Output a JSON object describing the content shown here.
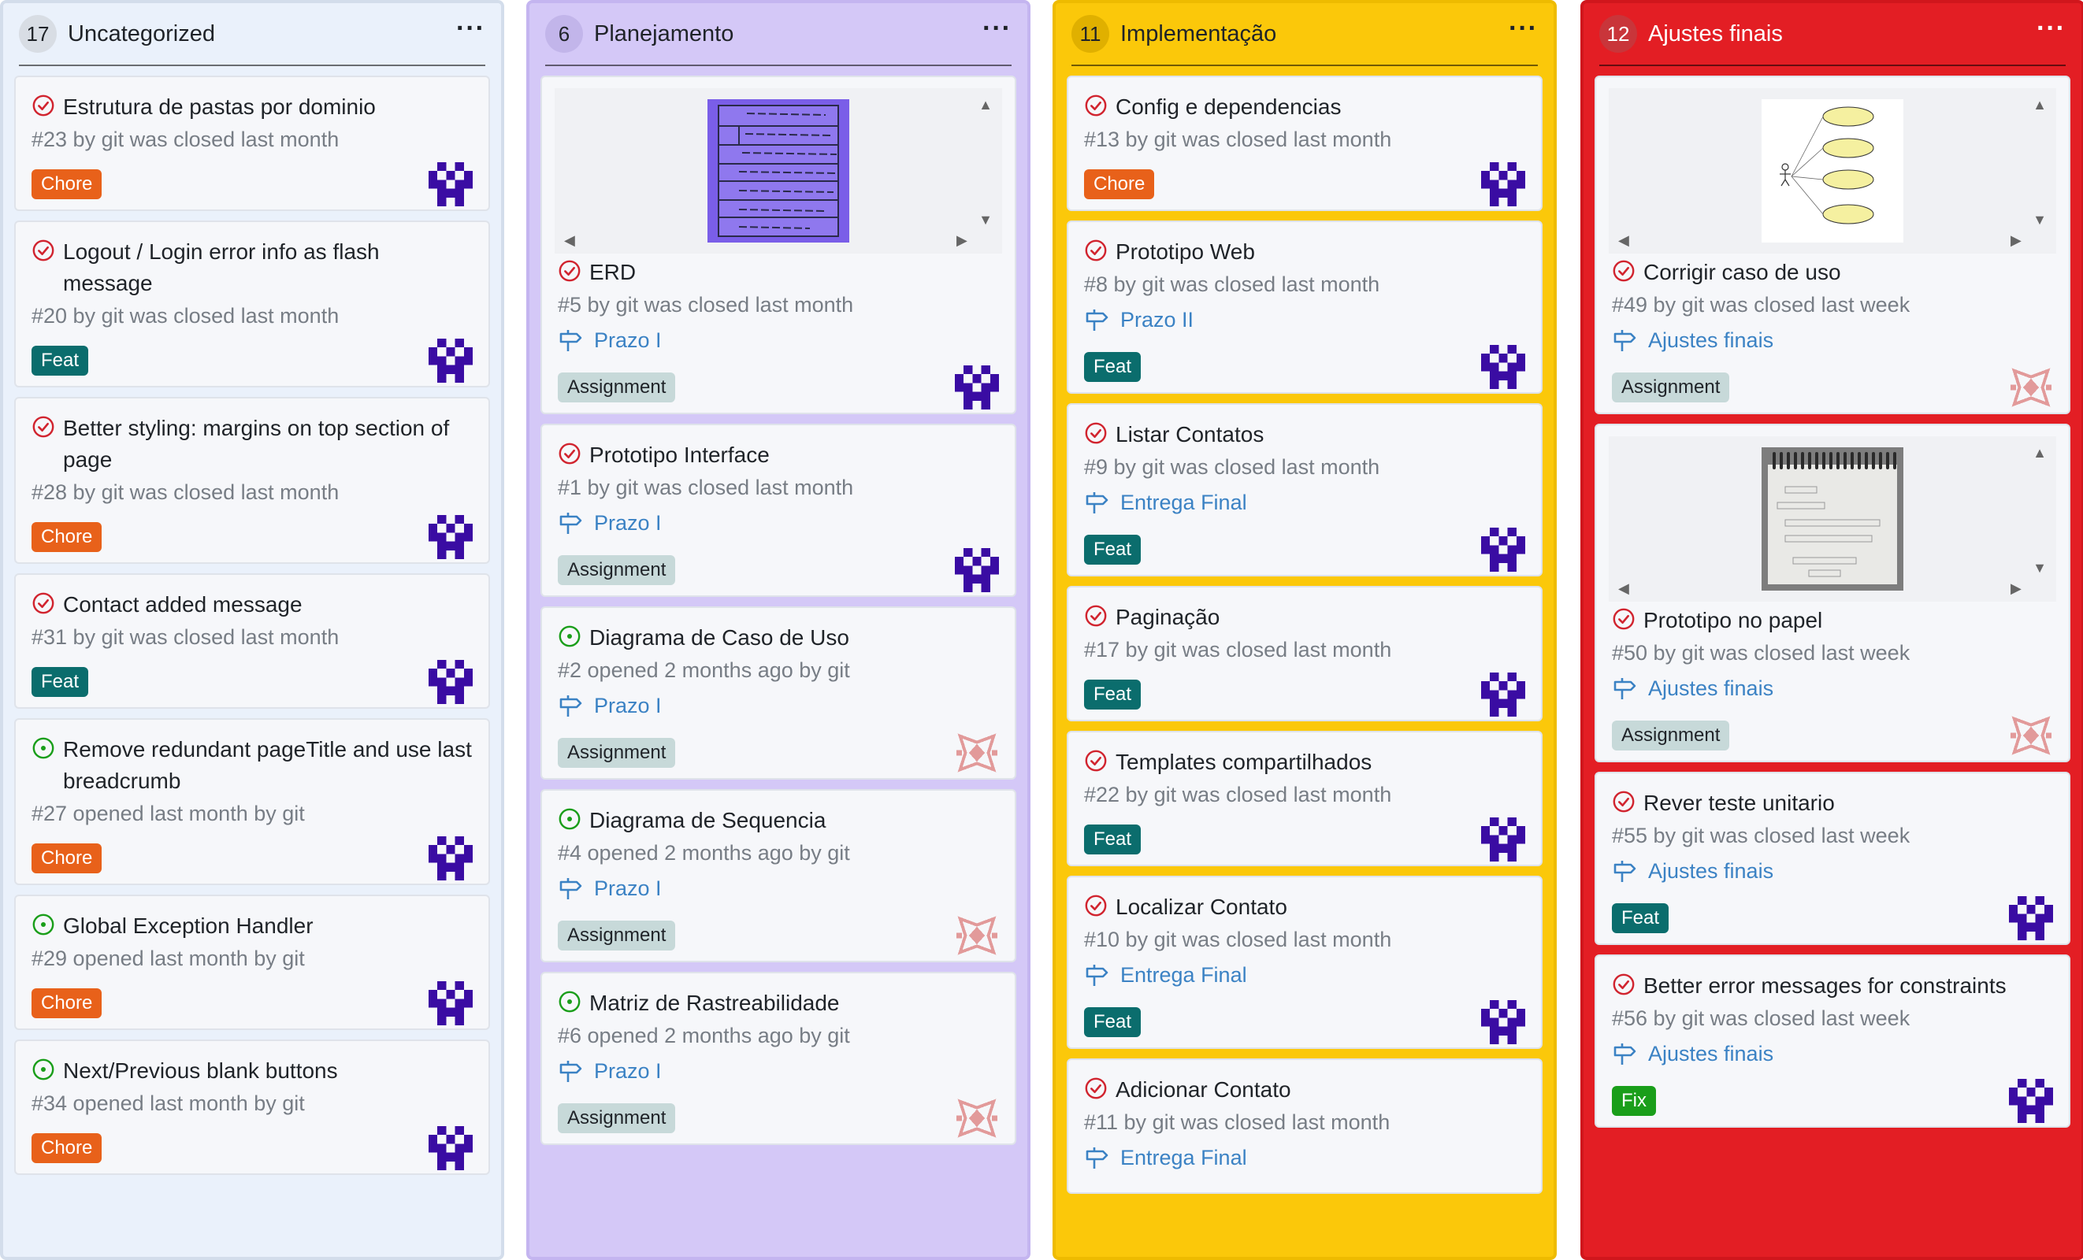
{
  "columns": [
    {
      "id": "uncategorized",
      "count": "17",
      "title": "Uncategorized",
      "colors": {
        "bg": "#eaf1fb",
        "border": "#d3ddeb",
        "badge": "#d8dde4",
        "text": "#1f2328"
      },
      "cards": [
        {
          "state": "closed",
          "title": "Estrutura de pastas por dominio",
          "meta": "#23 by git was closed last month",
          "label": "Chore",
          "label_kind": "chore",
          "avatar": "purple-identicon"
        },
        {
          "state": "closed",
          "title": "Logout / Login error info as flash message",
          "meta": "#20 by git was closed last month",
          "label": "Feat",
          "label_kind": "feat",
          "avatar": "purple-identicon"
        },
        {
          "state": "closed",
          "title": "Better styling: margins on top section of page",
          "meta": "#28 by git was closed last month",
          "label": "Chore",
          "label_kind": "chore",
          "avatar": "purple-identicon"
        },
        {
          "state": "closed",
          "title": "Contact added message",
          "meta": "#31 by git was closed last month",
          "label": "Feat",
          "label_kind": "feat",
          "avatar": "purple-identicon"
        },
        {
          "state": "open",
          "title": "Remove redundant pageTitle and use last breadcrumb",
          "meta": "#27 opened last month by git",
          "label": "Chore",
          "label_kind": "chore",
          "avatar": "purple-identicon"
        },
        {
          "state": "open",
          "title": "Global Exception Handler",
          "meta": "#29 opened last month by git",
          "label": "Chore",
          "label_kind": "chore",
          "avatar": "purple-identicon"
        },
        {
          "state": "open",
          "title": "Next/Previous blank buttons",
          "meta": "#34 opened last month by git",
          "label": "Chore",
          "label_kind": "chore",
          "avatar": "purple-identicon"
        }
      ]
    },
    {
      "id": "planejamento",
      "count": "6",
      "title": "Planejamento",
      "colors": {
        "bg": "#d4c8f7",
        "border": "#c4b5f0",
        "badge": "#c2b5ea",
        "text": "#1f2328"
      },
      "cards": [
        {
          "state": "closed",
          "title": "ERD",
          "meta": "#5 by git was closed last month",
          "milestone": "Prazo I",
          "label": "Assignment",
          "label_kind": "assignment",
          "avatar": "purple-identicon",
          "attachment": "erd-photo"
        },
        {
          "state": "closed",
          "title": "Prototipo Interface",
          "meta": "#1 by git was closed last month",
          "milestone": "Prazo I",
          "label": "Assignment",
          "label_kind": "assignment",
          "avatar": "purple-identicon"
        },
        {
          "state": "open",
          "title": "Diagrama de Caso de Uso",
          "meta": "#2 opened 2 months ago by git",
          "milestone": "Prazo I",
          "label": "Assignment",
          "label_kind": "assignment",
          "avatar": "pink-identicon"
        },
        {
          "state": "open",
          "title": "Diagrama de Sequencia",
          "meta": "#4 opened 2 months ago by git",
          "milestone": "Prazo I",
          "label": "Assignment",
          "label_kind": "assignment",
          "avatar": "pink-identicon"
        },
        {
          "state": "open",
          "title": "Matriz de Rastreabilidade",
          "meta": "#6 opened 2 months ago by git",
          "milestone": "Prazo I",
          "label": "Assignment",
          "label_kind": "assignment",
          "avatar": "pink-identicon"
        }
      ]
    },
    {
      "id": "implementacao",
      "count": "11",
      "title": "Implementação",
      "colors": {
        "bg": "#fbc80a",
        "border": "#eebb00",
        "badge": "#e0b000",
        "text": "#1f2328"
      },
      "cards": [
        {
          "state": "closed",
          "title": "Config e dependencias",
          "meta": "#13 by git was closed last month",
          "label": "Chore",
          "label_kind": "chore",
          "avatar": "purple-identicon"
        },
        {
          "state": "closed",
          "title": "Prototipo Web",
          "meta": "#8 by git was closed last month",
          "milestone": "Prazo II",
          "label": "Feat",
          "label_kind": "feat",
          "avatar": "purple-identicon"
        },
        {
          "state": "closed",
          "title": "Listar Contatos",
          "meta": "#9 by git was closed last month",
          "milestone": "Entrega Final",
          "label": "Feat",
          "label_kind": "feat",
          "avatar": "purple-identicon"
        },
        {
          "state": "closed",
          "title": "Paginação",
          "meta": "#17 by git was closed last month",
          "label": "Feat",
          "label_kind": "feat",
          "avatar": "purple-identicon"
        },
        {
          "state": "closed",
          "title": "Templates compartilhados",
          "meta": "#22 by git was closed last month",
          "label": "Feat",
          "label_kind": "feat",
          "avatar": "purple-identicon"
        },
        {
          "state": "closed",
          "title": "Localizar Contato",
          "meta": "#10 by git was closed last month",
          "milestone": "Entrega Final",
          "label": "Feat",
          "label_kind": "feat",
          "avatar": "purple-identicon"
        },
        {
          "state": "closed",
          "title": "Adicionar Contato",
          "meta": "#11 by git was closed last month",
          "milestone": "Entrega Final",
          "label": "",
          "label_kind": "",
          "avatar": ""
        }
      ]
    },
    {
      "id": "ajustes-finais",
      "count": "12",
      "title": "Ajustes finais",
      "colors": {
        "bg": "#e31e24",
        "border": "#d0161c",
        "badge": "#c9353a",
        "text": "#ffffff"
      },
      "cards": [
        {
          "state": "closed",
          "title": "Corrigir caso de uso",
          "meta": "#49 by git was closed last week",
          "milestone": "Ajustes finais",
          "label": "Assignment",
          "label_kind": "assignment",
          "avatar": "pink-identicon",
          "attachment": "usecase-diagram"
        },
        {
          "state": "closed",
          "title": "Prototipo no papel",
          "meta": "#50 by git was closed last week",
          "milestone": "Ajustes finais",
          "label": "Assignment",
          "label_kind": "assignment",
          "avatar": "pink-identicon",
          "attachment": "paper-sketch"
        },
        {
          "state": "closed",
          "title": "Rever teste unitario",
          "meta": "#55 by git was closed last week",
          "milestone": "Ajustes finais",
          "label": "Feat",
          "label_kind": "feat",
          "avatar": "purple-identicon"
        },
        {
          "state": "closed",
          "title": "Better error messages for constraints",
          "meta": "#56 by git was closed last week",
          "milestone": "Ajustes finais",
          "label": "Fix",
          "label_kind": "fix",
          "avatar": "purple-identicon"
        }
      ]
    }
  ],
  "icons": {
    "closed_state": "closed-issue-icon",
    "open_state": "open-issue-icon",
    "milestone": "milestone-signpost-icon",
    "menu": "more-options-icon"
  },
  "accent_colors": {
    "closed": "#d1242f",
    "open": "#1a9e1a",
    "milestone": "#3b82c4",
    "purple_avatar": "#3a0ca3",
    "pink_avatar": "#e29a9a"
  }
}
